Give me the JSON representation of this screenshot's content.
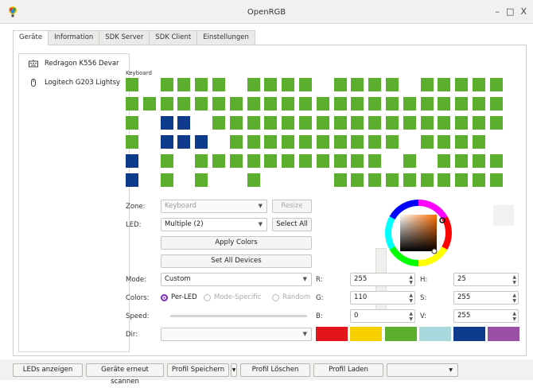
{
  "window": {
    "title": "OpenRGB",
    "minimize": "–",
    "maximize": "□",
    "close": "X"
  },
  "tabs": [
    {
      "label": "Geräte",
      "active": true
    },
    {
      "label": "Information",
      "active": false
    },
    {
      "label": "SDK Server",
      "active": false
    },
    {
      "label": "SDK Client",
      "active": false
    },
    {
      "label": "Einstellungen",
      "active": false
    }
  ],
  "devices": [
    {
      "label": "Redragon K556 Devar",
      "icon": "keyboard-icon"
    },
    {
      "label": "Logitech G203 Lightsy",
      "icon": "mouse-icon"
    }
  ],
  "keyboard": {
    "label": "Keyboard",
    "selected_color": "#0d3a8a",
    "key_color": "#5cae2f"
  },
  "controls": {
    "zone_label": "Zone:",
    "zone_value": "Keyboard",
    "resize_label": "Resize",
    "led_label": "LED:",
    "led_value": "Multiple (2)",
    "select_all_label": "Select All",
    "apply_colors_label": "Apply Colors",
    "set_all_devices_label": "Set All Devices",
    "mode_label": "Mode:",
    "mode_value": "Custom",
    "colors_label": "Colors:",
    "per_led_label": "Per-LED",
    "mode_specific_label": "Mode-Specific",
    "random_label": "Random",
    "speed_label": "Speed:",
    "dir_label": "Dir:"
  },
  "color": {
    "r_label": "R:",
    "r_value": "255",
    "g_label": "G:",
    "g_value": "110",
    "b_label": "B:",
    "b_value": "0",
    "h_label": "H:",
    "h_value": "25",
    "s_label": "S:",
    "s_value": "255",
    "v_label": "V:",
    "v_value": "255"
  },
  "swatches": [
    "#e3161b",
    "#f7cf00",
    "#5cae2f",
    "#a7d9dc",
    "#0d3a8a",
    "#9a4fa5"
  ],
  "bottom": {
    "leds_anzeigen": "LEDs anzeigen",
    "rescan": "Geräte erneut scannen",
    "profil_speichern": "Profil Speichern",
    "profil_loeschen": "Profil Löschen",
    "profil_laden": "Profil Laden",
    "profile_select": ""
  }
}
